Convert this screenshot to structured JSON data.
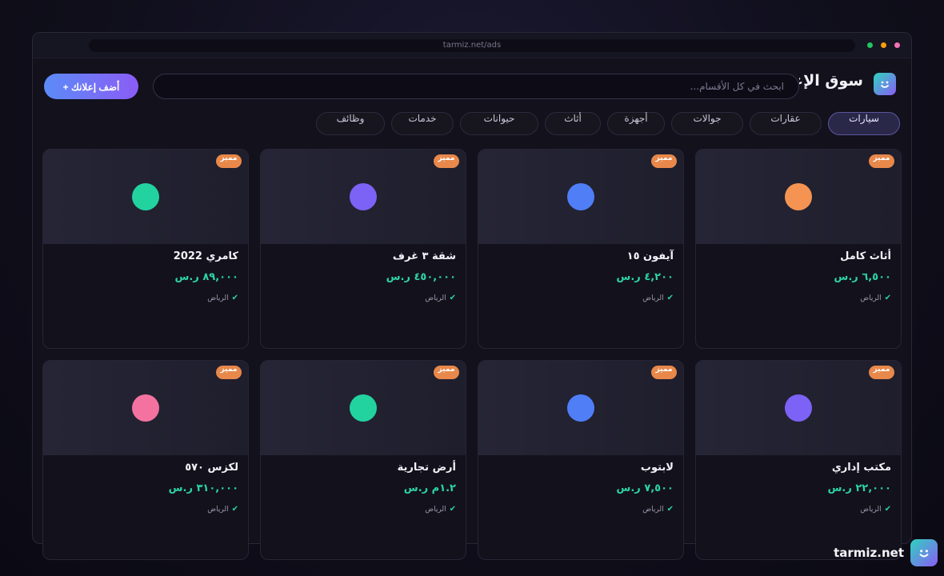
{
  "browser": {
    "url": "tarmiz.net/ads",
    "window_dots": [
      "#22c55e",
      "#f59e0b",
      "#f472b6"
    ]
  },
  "header": {
    "title": "سوق الإعلانات",
    "search_placeholder": "ابحث في كل الأقسام...",
    "add_button": "أضف إعلانك +"
  },
  "categories": [
    {
      "label": "سيارات",
      "active": true
    },
    {
      "label": "عقارات",
      "active": false
    },
    {
      "label": "جوالات",
      "active": false
    },
    {
      "label": "أجهزة",
      "active": false
    },
    {
      "label": "أثاث",
      "active": false
    },
    {
      "label": "حيوانات",
      "active": false
    },
    {
      "label": "خدمات",
      "active": false
    },
    {
      "label": "وظائف",
      "active": false
    }
  ],
  "listings": [
    {
      "title": "أثاث كامل",
      "price": "٦,٥٠٠ ر.س",
      "location": "الرياض",
      "badge": "مميز",
      "color": "#f59452"
    },
    {
      "title": "آيفون ١٥",
      "price": "٤,٢٠٠ ر.س",
      "location": "الرياض",
      "badge": "مميز",
      "color": "#4f7ef7"
    },
    {
      "title": "شقة ٣ غرف",
      "price": "٤٥٠,٠٠٠ ر.س",
      "location": "الرياض",
      "badge": "مميز",
      "color": "#7c62f5"
    },
    {
      "title": "كامري 2022",
      "price": "٨٩,٠٠٠ ر.س",
      "location": "الرياض",
      "badge": "مميز",
      "color": "#22d3a0"
    },
    {
      "title": "مكتب إداري",
      "price": "٢٢,٠٠٠ ر.س",
      "location": "الرياض",
      "badge": "مميز",
      "color": "#7c62f5"
    },
    {
      "title": "لابتوب",
      "price": "٧,٥٠٠ ر.س",
      "location": "الرياض",
      "badge": "مميز",
      "color": "#4f7ef7"
    },
    {
      "title": "أرض تجارية",
      "price": "١.٢م ر.س",
      "location": "الرياض",
      "badge": "مميز",
      "color": "#22d3a0"
    },
    {
      "title": "لكزس ٥٧٠",
      "price": "٣١٠,٠٠٠ ر.س",
      "location": "الرياض",
      "badge": "مميز",
      "color": "#f472a0"
    }
  ],
  "branding": {
    "text": "tarmiz.net"
  },
  "icons": {
    "logo": "smile-icon",
    "location_check": "check-icon"
  }
}
